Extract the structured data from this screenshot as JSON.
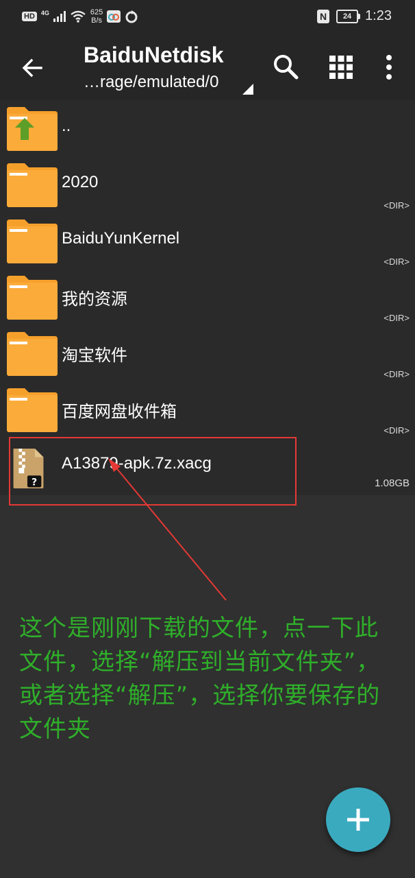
{
  "status_bar": {
    "hd_badge": "HD",
    "network_type": "4G",
    "net_speed_value": "625",
    "net_speed_unit": "B/s",
    "battery_level": "24",
    "time": "1:23"
  },
  "toolbar": {
    "title": "BaiduNetdisk",
    "path": "…rage/emulated/0"
  },
  "files": [
    {
      "name": "..",
      "meta": "",
      "type": "parent-folder"
    },
    {
      "name": "2020",
      "meta": "<DIR>",
      "type": "folder"
    },
    {
      "name": "BaiduYunKernel",
      "meta": "<DIR>",
      "type": "folder"
    },
    {
      "name": "我的资源",
      "meta": "<DIR>",
      "type": "folder"
    },
    {
      "name": "淘宝软件",
      "meta": "<DIR>",
      "type": "folder"
    },
    {
      "name": "百度网盘收件箱",
      "meta": "<DIR>",
      "type": "folder"
    },
    {
      "name": "A13879-apk.7z.xacg",
      "meta": "1.08GB",
      "type": "archive-unknown"
    }
  ],
  "annotation": {
    "text": "这个是刚刚下载的文件，点一下此文件，选择“解压到当前文件夹”，或者选择“解压”，选择你要保存的文件夹",
    "color": "#2faf2a"
  },
  "colors": {
    "folder": "#f8a330",
    "highlight": "#e53935",
    "fab": "#3aaabf"
  }
}
